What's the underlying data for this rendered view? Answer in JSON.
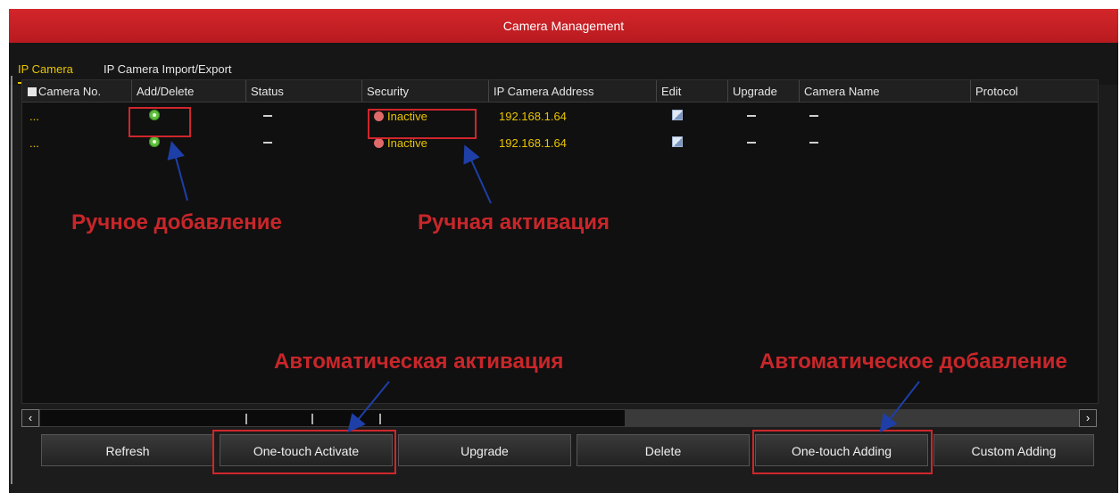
{
  "window": {
    "title": "Camera Management"
  },
  "tabs": [
    {
      "label": "IP Camera",
      "active": true
    },
    {
      "label": "IP Camera Import/Export",
      "active": false
    }
  ],
  "table": {
    "headers": [
      "Camera No.",
      "Add/Delete",
      "Status",
      "Security",
      "IP Camera Address",
      "Edit",
      "Upgrade",
      "Camera Name",
      "Protocol"
    ],
    "rows": [
      {
        "camera_no": "...",
        "security": "Inactive",
        "ip": "192.168.1.64"
      },
      {
        "camera_no": "...",
        "security": "Inactive",
        "ip": "192.168.1.64"
      }
    ]
  },
  "annotations": {
    "manual_add": "Ручное добавление",
    "manual_activate": "Ручная активация",
    "auto_activate": "Автоматическая активация",
    "auto_add": "Автоматическое добавление"
  },
  "buttons": {
    "refresh": "Refresh",
    "one_touch_activate": "One-touch Activate",
    "upgrade": "Upgrade",
    "delete": "Delete",
    "one_touch_adding": "One-touch Adding",
    "custom_adding": "Custom Adding"
  },
  "scrollbar": {
    "left_glyph": "‹",
    "right_glyph": "›"
  },
  "colors": {
    "titlebar": "#c8202a",
    "accent_yellow": "#e8c400",
    "annotation_red": "#c8262a",
    "arrow_blue": "#1e3fa8"
  }
}
